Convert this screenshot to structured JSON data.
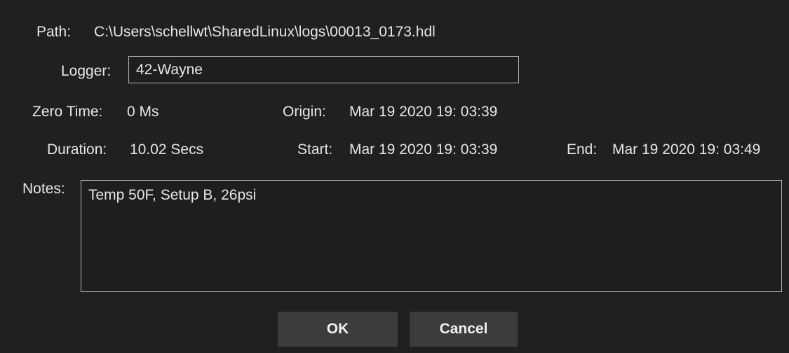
{
  "path": {
    "label": "Path:",
    "value": "C:\\Users\\schellwt\\SharedLinux\\logs\\00013_0173.hdl"
  },
  "logger": {
    "label": "Logger:",
    "value": "42-Wayne"
  },
  "zero_time": {
    "label": "Zero Time:",
    "value": "0  Ms"
  },
  "origin": {
    "label": "Origin:",
    "value": "Mar 19 2020 19: 03:39"
  },
  "duration": {
    "label": "Duration:",
    "value": "10.02 Secs"
  },
  "start": {
    "label": "Start:",
    "value": "Mar 19 2020 19: 03:39"
  },
  "end": {
    "label": "End:",
    "value": "Mar 19 2020 19: 03:49"
  },
  "notes": {
    "label": "Notes:",
    "value": "Temp 50F, Setup B, 26psi"
  },
  "buttons": {
    "ok": "OK",
    "cancel": "Cancel"
  },
  "colors": {
    "background": "#202020",
    "text": "#e6e6e6",
    "field_border": "#b4b4b4",
    "button_bg": "#3c3c3c"
  }
}
